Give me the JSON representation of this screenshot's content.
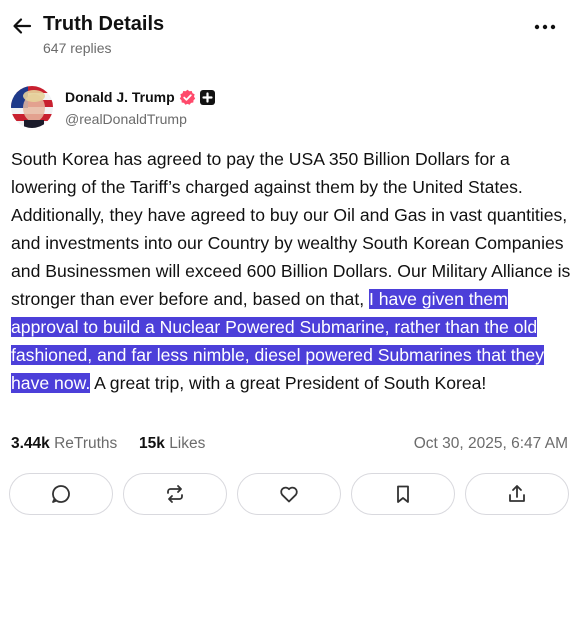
{
  "header": {
    "title": "Truth Details",
    "replies": "647 replies"
  },
  "author": {
    "display_name": "Donald J. Trump",
    "handle": "@realDonaldTrump"
  },
  "post": {
    "text_before": "South Korea has agreed to pay the USA 350 Billion Dollars for a lowering of the Tariff’s charged against them by the United States. Additionally, they have agreed to buy our Oil and Gas in vast quantities, and investments into our Country by wealthy South Korean Companies and Businessmen will exceed 600 Billion Dollars. Our Military Alliance is stronger than ever before and, based on that, ",
    "text_highlighted": "I have given them approval to build a Nuclear Powered Submarine, rather than the old fashioned, and far less nimble, diesel powered Submarines that they have now.",
    "text_after": " A great trip, with a great President of South Korea!"
  },
  "stats": {
    "retruths_count": "3.44k",
    "retruths_label": "ReTruths",
    "likes_count": "15k",
    "likes_label": "Likes",
    "timestamp": "Oct 30, 2025, 6:47 AM"
  },
  "colors": {
    "highlight": "#4c3fd9",
    "verified": "#ff4a6b",
    "muted_text": "#6b6b6b",
    "button_border": "#d9d9de"
  },
  "icons": {
    "back": "arrow-left-icon",
    "more": "more-horizontal-icon",
    "verified": "verified-badge-icon",
    "plus": "plus-badge-icon",
    "reply": "reply-icon",
    "retruth": "retruth-icon",
    "like": "heart-icon",
    "bookmark": "bookmark-icon",
    "share": "share-icon"
  }
}
